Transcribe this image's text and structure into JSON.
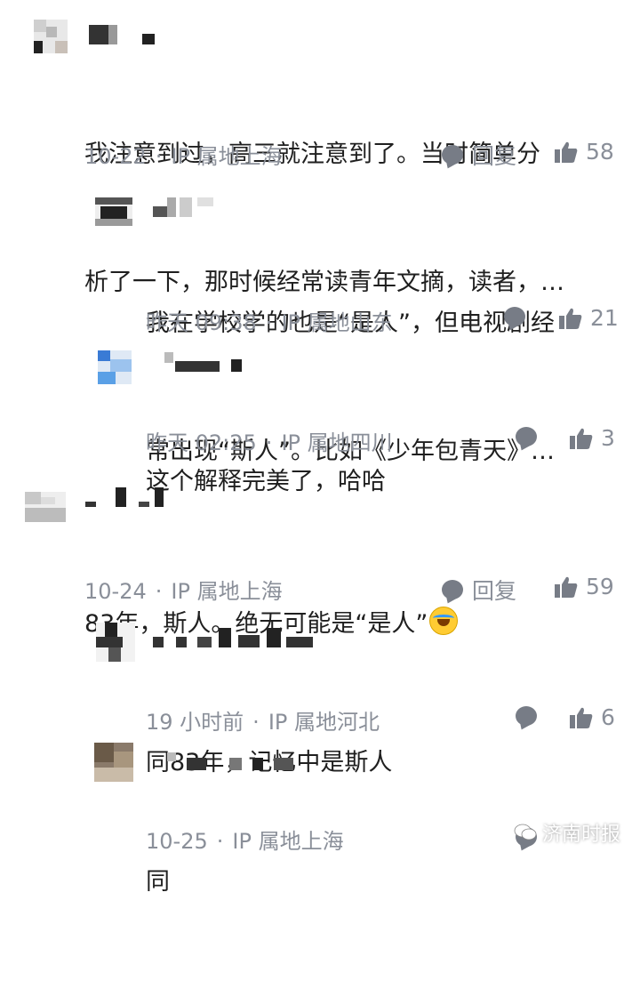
{
  "comments": [
    {
      "text_lines": [
        "我注意到过，高三就注意到了。当时简单分",
        "析了一下，那时候经常读青年文摘，读者，…"
      ],
      "date": "10-22",
      "ip": "IP 属地上海",
      "reply_label": "回复",
      "likes": "58"
    },
    {
      "text_lines": [
        "我在学校学的也是“是人”，但电视剧经",
        "常出现“斯人”。比如《少年包青天》…"
      ],
      "date": "昨天 09:38",
      "ip": "IP 属地山东",
      "likes": "21"
    },
    {
      "text_lines": [
        "这个解释完美了，哈哈"
      ],
      "date": "昨天 02:25",
      "ip": "IP 属地四川",
      "likes": "3"
    },
    {
      "text_lines": [
        "83年，斯人。绝无可能是“是人”"
      ],
      "date": "10-24",
      "ip": "IP 属地上海",
      "reply_label": "回复",
      "likes": "59"
    },
    {
      "text_lines": [
        "同83年，记忆中是斯人"
      ],
      "date": "19 小时前",
      "ip": "IP 属地河北",
      "likes": "6"
    },
    {
      "text_lines": [
        "同"
      ],
      "date": "10-25",
      "ip": "IP 属地上海"
    }
  ],
  "watermark": {
    "label": "济南时报"
  },
  "colors": {
    "meta_gray": "#8a8f99",
    "icon_gray": "#777c86",
    "text": "#1f1f1f"
  },
  "icons": [
    "comment-bubble-icon",
    "thumbs-up-icon",
    "laughing-crying-emoji-icon",
    "wechat-logo-icon"
  ]
}
